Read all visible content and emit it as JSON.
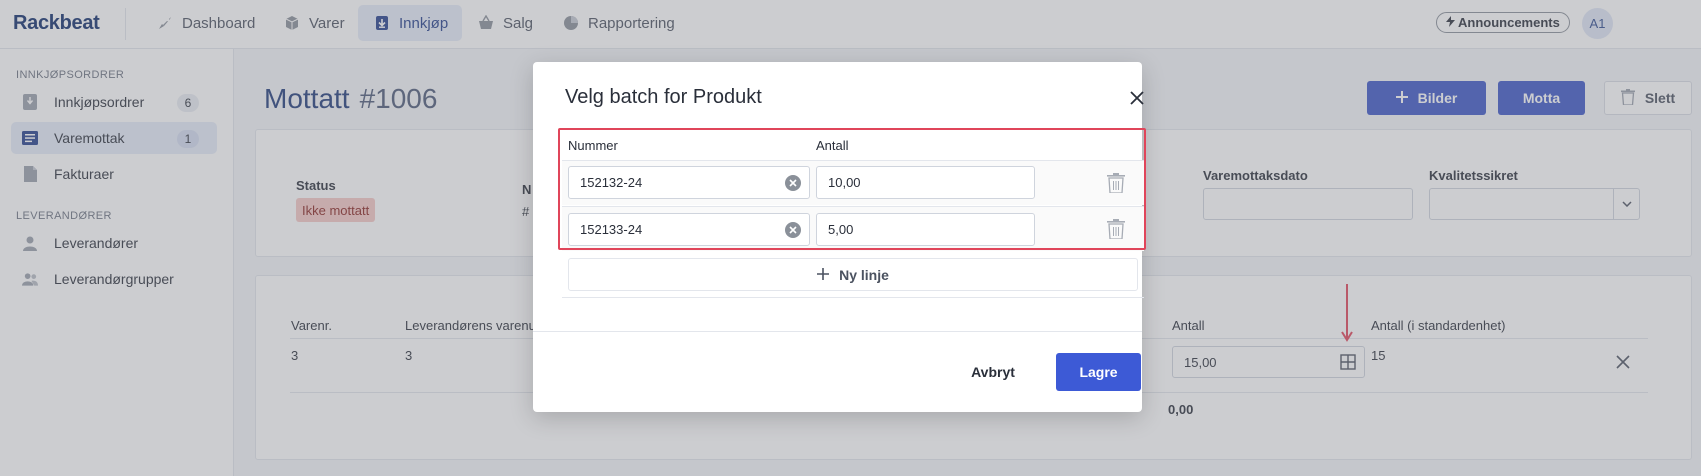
{
  "app": {
    "logo": "Rackbeat"
  },
  "nav": {
    "items": [
      {
        "label": "Dashboard",
        "icon": "rocket-icon"
      },
      {
        "label": "Varer",
        "icon": "cube-icon"
      },
      {
        "label": "Innkjøp",
        "icon": "download-box-icon",
        "active": true
      },
      {
        "label": "Salg",
        "icon": "basket-icon"
      },
      {
        "label": "Rapportering",
        "icon": "pie-chart-icon"
      }
    ],
    "announcements_label": "Announcements",
    "avatar_initials": "A1"
  },
  "sidebar": {
    "section1": "INNKJØPSORDRER",
    "items1": [
      {
        "label": "Innkjøpsordrer",
        "badge": "6",
        "icon": "purchase-order-icon"
      },
      {
        "label": "Varemottak",
        "badge": "1",
        "icon": "list-icon",
        "active": true
      },
      {
        "label": "Fakturaer",
        "icon": "invoice-icon"
      }
    ],
    "section2": "LEVERANDØRER",
    "items2": [
      {
        "label": "Leverandører",
        "icon": "person-icon"
      },
      {
        "label": "Leverandørgrupper",
        "icon": "people-icon"
      }
    ]
  },
  "page": {
    "title": "Mottatt",
    "number": "#1006",
    "btn_images": "Bilder",
    "btn_receive": "Motta",
    "btn_delete": "Slett",
    "status_label": "Status",
    "status_value": "Ikke mottatt",
    "partial_label_n": "N",
    "partial_value_hash": "#",
    "receipt_date_label": "Varemottaksdato",
    "quality_label": "Kvalitetssikret"
  },
  "lines_table": {
    "headers": [
      "Varenr.",
      "Leverandørens varenu",
      "Antall",
      "Antall (i standardenhet)"
    ],
    "row": {
      "item_no": "3",
      "supplier_item_no": "3",
      "quantity": "15,00",
      "quantity_std": "15"
    },
    "total_partial": "0,00"
  },
  "modal": {
    "title": "Velg batch for Produkt",
    "col_number": "Nummer",
    "col_quantity": "Antall",
    "rows": [
      {
        "number": "152132-24",
        "quantity": "10,00"
      },
      {
        "number": "152133-24",
        "quantity": "5,00"
      }
    ],
    "new_line": "Ny linje",
    "cancel": "Avbryt",
    "save": "Lagre"
  },
  "colors": {
    "accent": "#3c56c7",
    "highlight": "#e0455a",
    "status_bg": "#f6c9c6"
  }
}
